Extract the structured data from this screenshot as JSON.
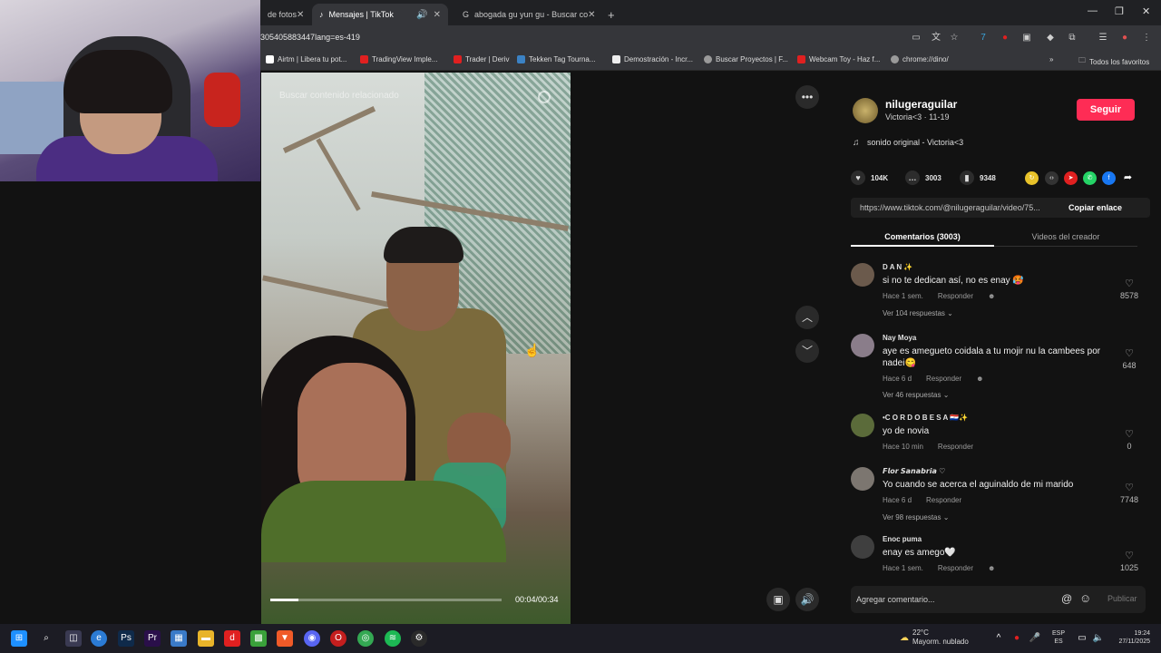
{
  "browser": {
    "tabs": [
      {
        "label": "de fotos",
        "active": false
      },
      {
        "label": "Mensajes | TikTok",
        "active": true
      },
      {
        "label": "abogada gu yun gu - Buscar co",
        "active": false
      }
    ],
    "new_tab": "+",
    "url": "305405883447lang=es-419",
    "bookmarks": [
      {
        "label": "Airtm | Libera tu pot...",
        "color": "#ffffff"
      },
      {
        "label": "TradingView Imple...",
        "color": "#e02020"
      },
      {
        "label": "Trader | Deriv",
        "color": "#e02020"
      },
      {
        "label": "Tekken Tag Tourna...",
        "color": "#3b82c4"
      },
      {
        "label": "Demostración - Incr...",
        "color": "#eeeeee"
      },
      {
        "label": "Buscar Proyectos | F...",
        "color": "#9a9a9a"
      },
      {
        "label": "Webcam Toy - Haz f...",
        "color": "#e02020"
      },
      {
        "label": "chrome://dino/",
        "color": "#9a9a9a"
      }
    ],
    "all_bookmarks": "Todos los favoritos"
  },
  "video": {
    "search_placeholder": "Buscar contenido relacionado",
    "time": "00:04/00:34",
    "progress": 0.12
  },
  "post": {
    "username": "nilugeraguilar",
    "subtitle": "Victoria<3 · 11-19",
    "follow_label": "Seguir",
    "music": "sonido original - Victoria<3",
    "likes": "104K",
    "comments_count": "3003",
    "saves": "9348",
    "link": "https://www.tiktok.com/@nilugeraguilar/video/75...",
    "copy_label": "Copiar enlace",
    "tab_comments": "Comentarios (3003)",
    "tab_creator": "Videos del creador"
  },
  "comments": [
    {
      "name": "D A N ✨",
      "text": "si no te dedican así, no es enay 🥵",
      "time": "Hace 1 sem.",
      "reply": "Responder",
      "likes": "8578",
      "replies": "Ver 104 respuestas ⌄",
      "avatar_color": "#6b5a4c"
    },
    {
      "name": "Nay Moya",
      "text": "aye es amegueto coidala a tu mojir nu la cambees por nadei😋",
      "time": "Hace 6 d",
      "reply": "Responder",
      "likes": "648",
      "replies": "Ver 46 respuestas ⌄",
      "avatar_color": "#8a7d8a"
    },
    {
      "name": "•C O R D O B E S A 🇵🇾✨",
      "text": "yo de novia",
      "time": "Hace 10 min",
      "reply": "Responder",
      "likes": "0",
      "replies": "",
      "avatar_color": "#5b6b3a"
    },
    {
      "name": "𝙁𝙡𝙤𝙧 𝙎𝙖𝙣𝙖𝙗𝙧𝙞𝙖 ♡",
      "text": "Yo cuando se acerca el aguinaldo de mi marido",
      "time": "Hace 6 d",
      "reply": "Responder",
      "likes": "7748",
      "replies": "Ver 98 respuestas ⌄",
      "avatar_color": "#7c7670"
    },
    {
      "name": "Enoc puma",
      "text": "enay es amego🤍",
      "time": "Hace 1 sem.",
      "reply": "Responder",
      "likes": "1025",
      "replies": "",
      "avatar_color": "#3f3f3f"
    }
  ],
  "composer": {
    "placeholder": "Agregar comentario...",
    "publish": "Publicar"
  },
  "taskbar": {
    "weather_temp": "22°C",
    "weather_desc": "Mayorm. nublado",
    "lang1": "ESP",
    "lang2": "ES",
    "time": "19:24",
    "date": "27/11/2025"
  }
}
